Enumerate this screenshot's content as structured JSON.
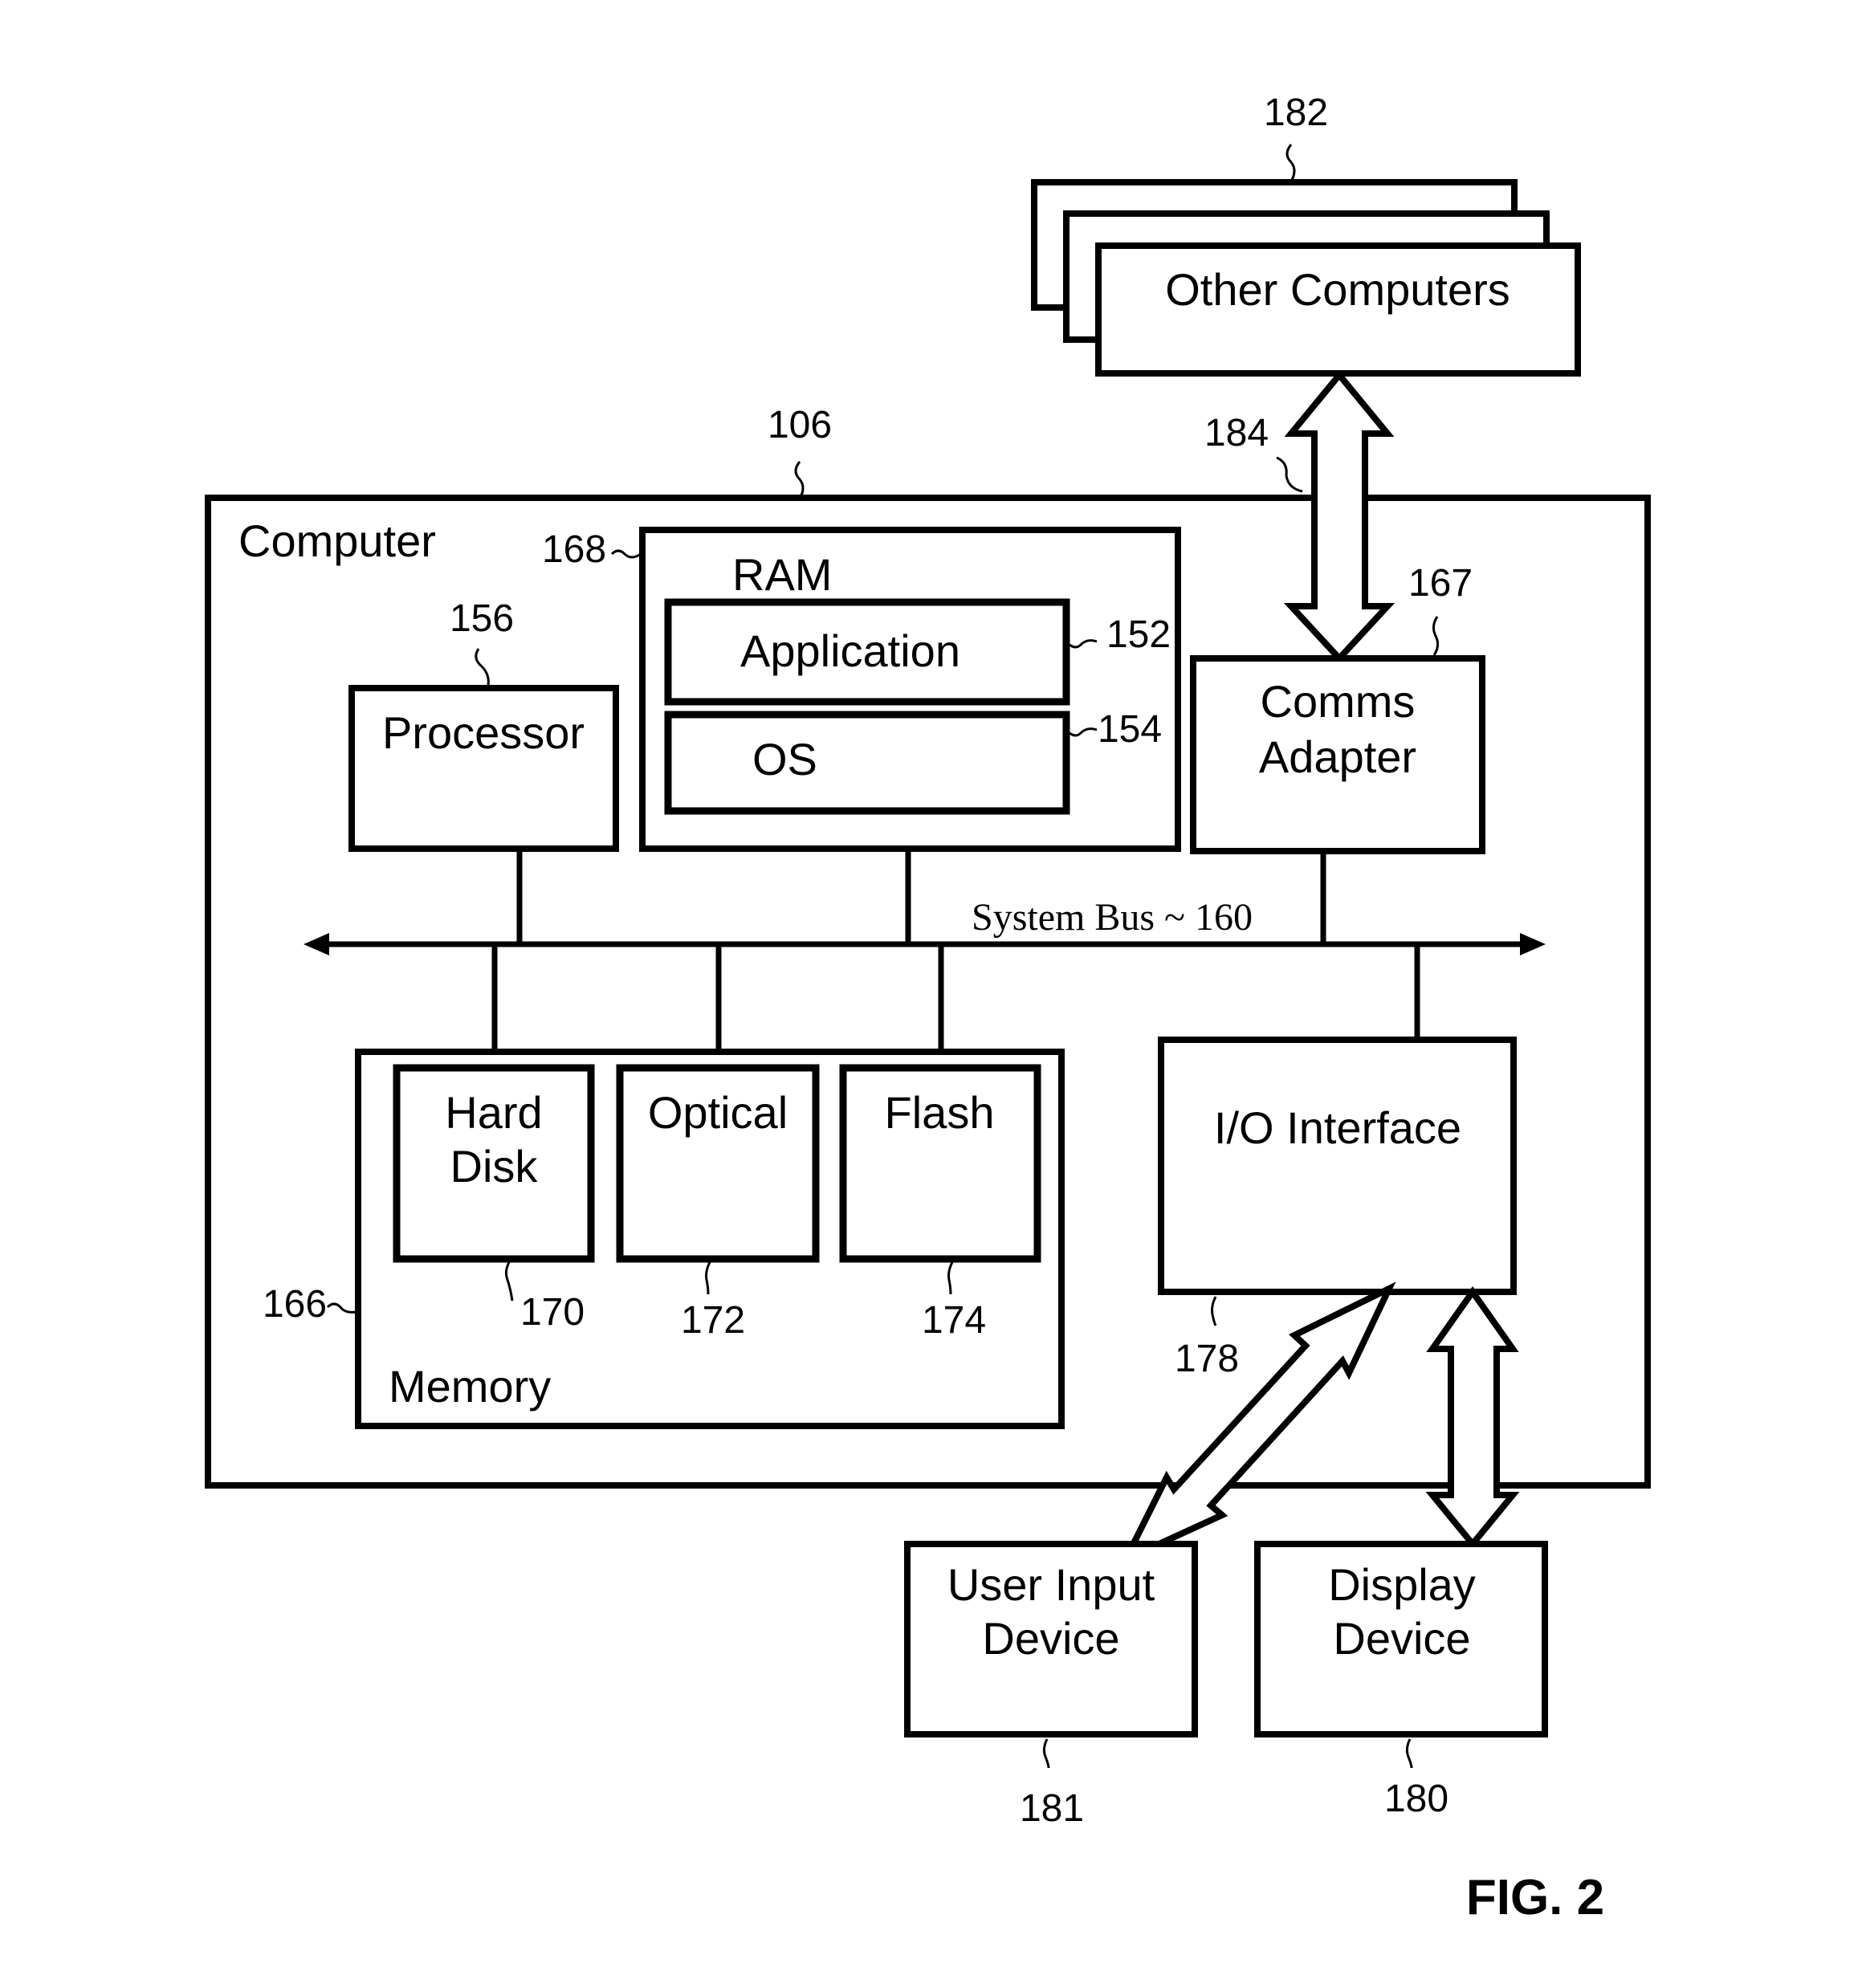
{
  "figure": {
    "caption": "FIG. 2"
  },
  "other_computers": {
    "label": "Other Computers",
    "ref": "182",
    "link_ref": "184"
  },
  "computer": {
    "label": "Computer",
    "ref": "106",
    "ram": {
      "label": "RAM",
      "ref": "168",
      "application": {
        "label": "Application",
        "ref": "152"
      },
      "os": {
        "label": "OS",
        "ref": "154"
      }
    },
    "processor": {
      "label": "Processor",
      "ref": "156"
    },
    "comms_adapter": {
      "label_line1": "Comms",
      "label_line2": "Adapter",
      "ref": "167"
    },
    "system_bus": {
      "label": "System Bus ~ 160"
    },
    "memory": {
      "label": "Memory",
      "ref": "166",
      "hard_disk": {
        "label_line1": "Hard",
        "label_line2": "Disk",
        "ref": "170"
      },
      "optical": {
        "label": "Optical",
        "ref": "172"
      },
      "flash": {
        "label": "Flash",
        "ref": "174"
      }
    },
    "io_interface": {
      "label": "I/O Interface",
      "ref": "178"
    }
  },
  "user_input_device": {
    "label_line1": "User Input",
    "label_line2": "Device",
    "ref": "181"
  },
  "display_device": {
    "label_line1": "Display",
    "label_line2": "Device",
    "ref": "180"
  }
}
